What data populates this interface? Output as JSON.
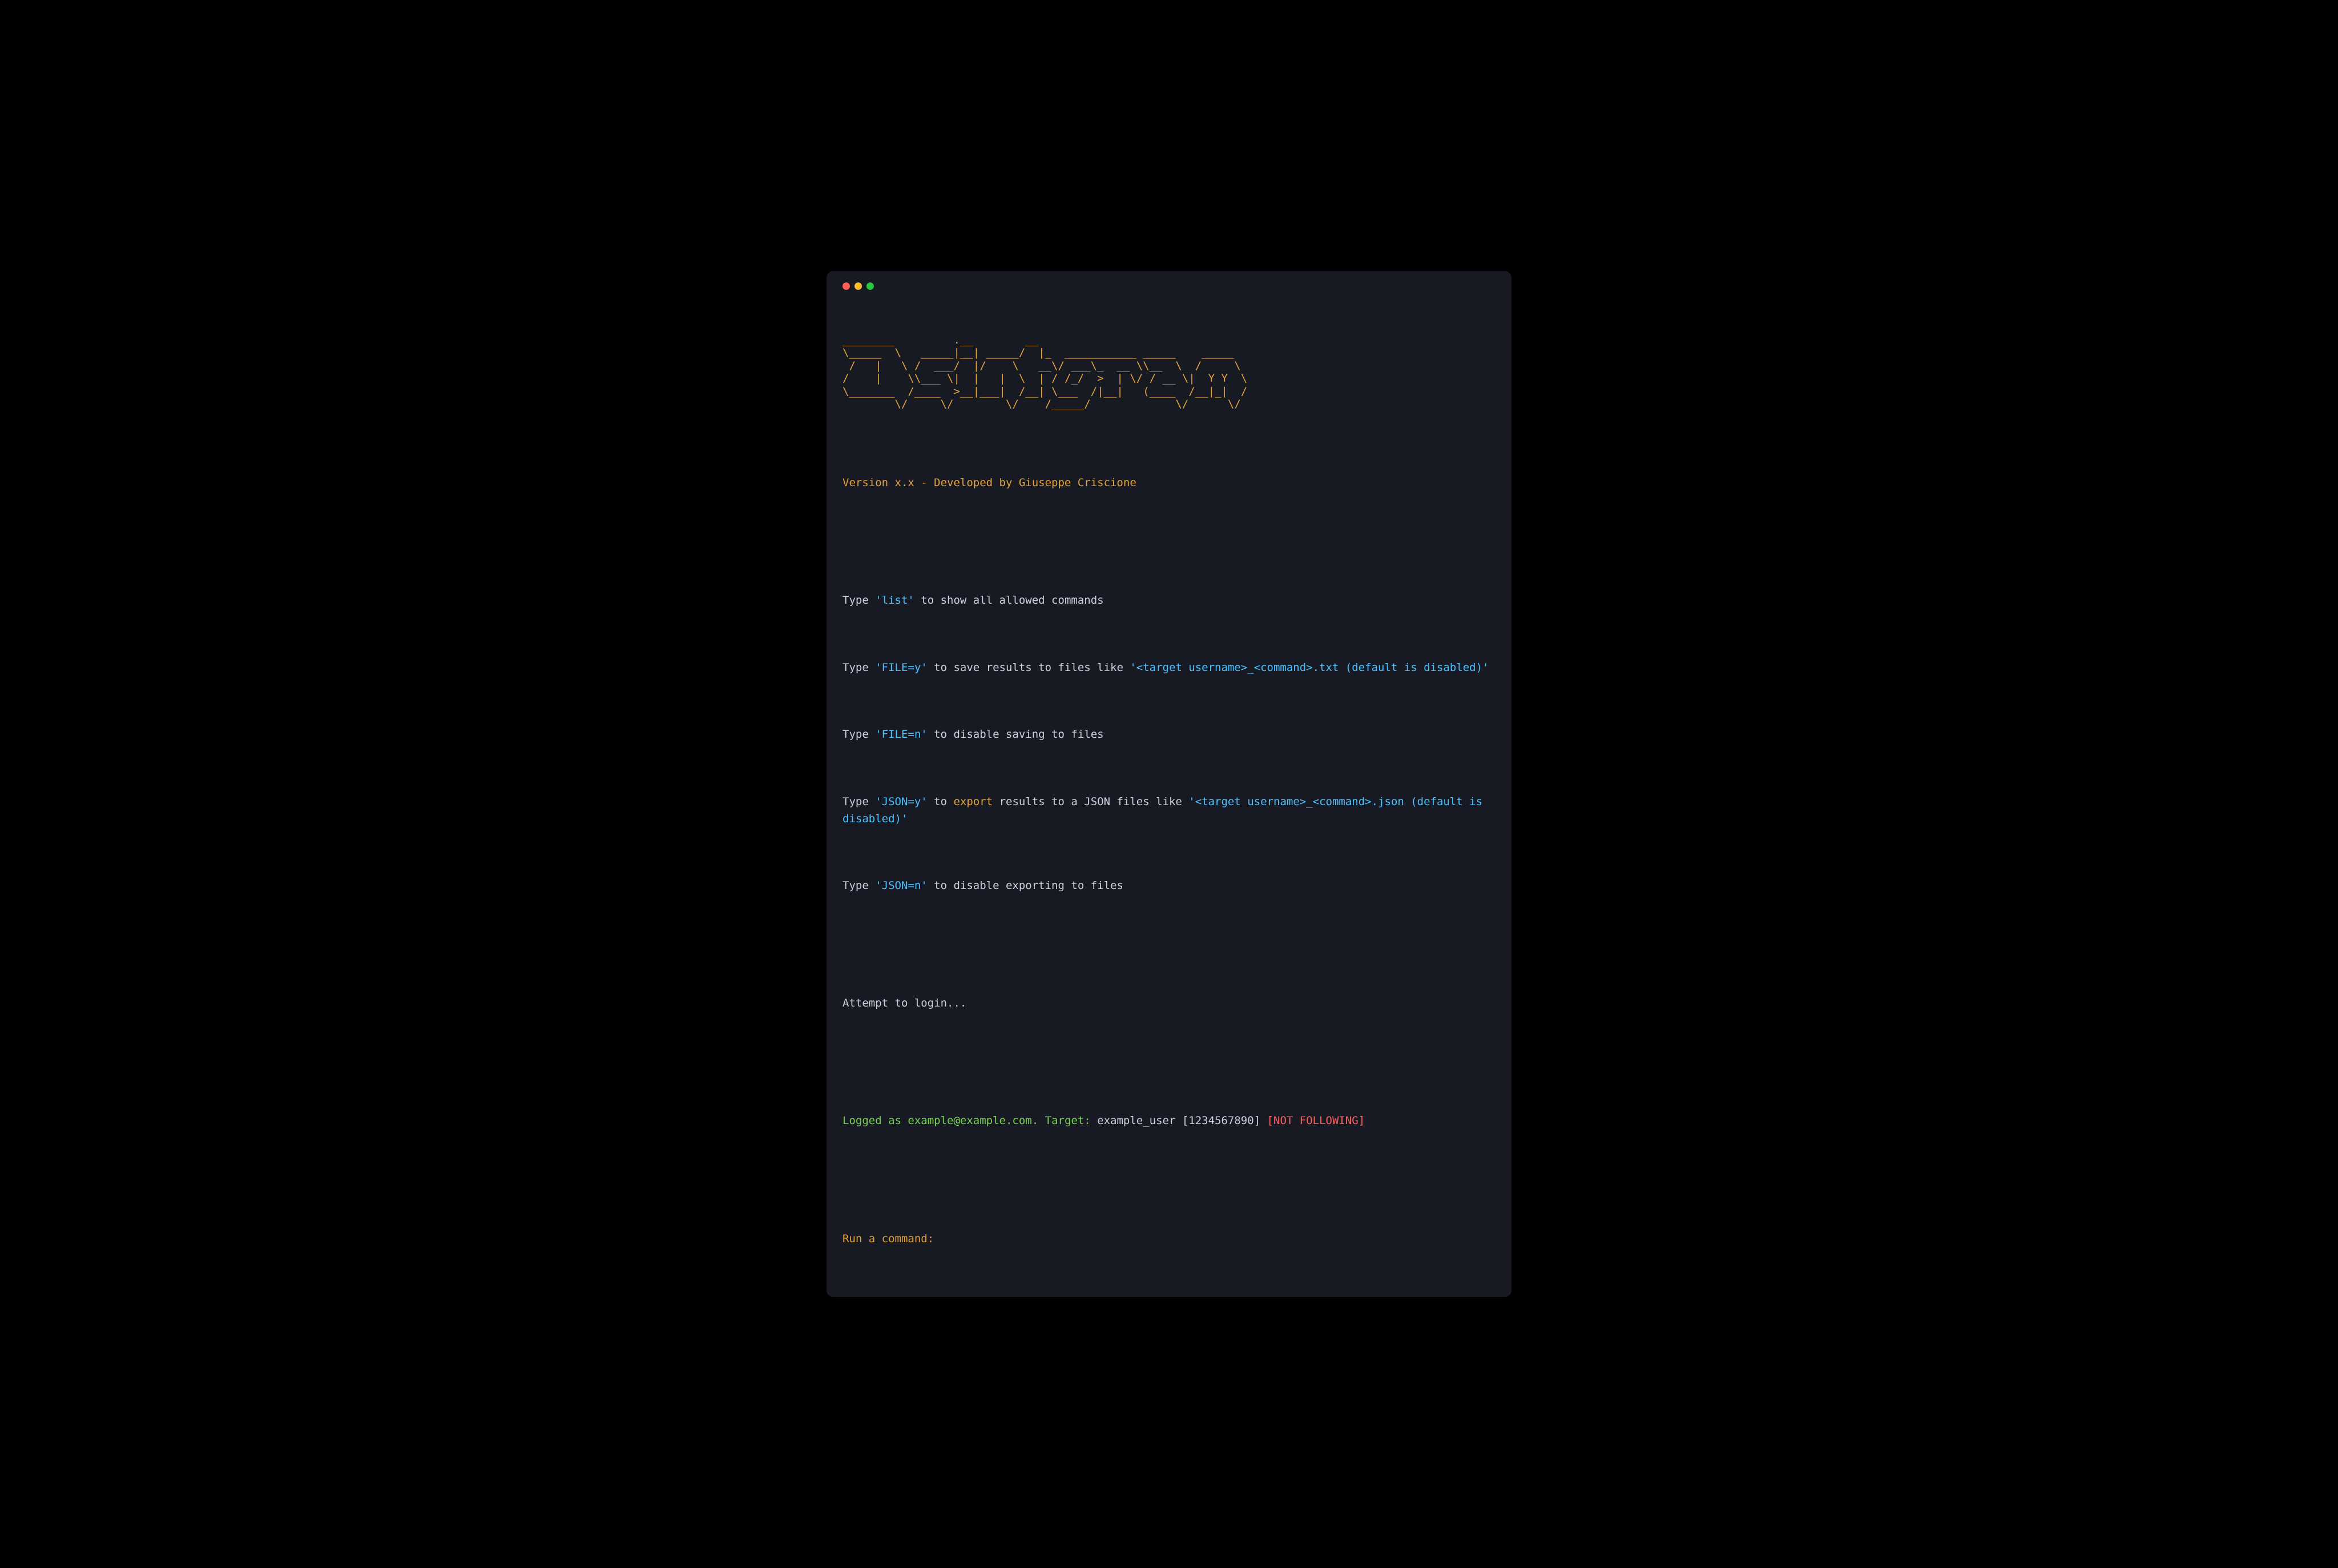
{
  "ascii_banner": "________         .__        __                                  \n\\_____  \\   _____|__| _____/  |_  ___________ _____    _____   \n /   |   \\ /  ___/  |/    \\   __\\/ ___\\_  __ \\\\__  \\  /     \\  \n/    |    \\\\___ \\|  |   |  \\  | / /_/  >  | \\/ / __ \\|  Y Y  \\ \n\\_______  /____  >__|___|  /__| \\___  /|__|   (____  /__|_|  / \n        \\/     \\/        \\/    /_____/             \\/      \\/ ",
  "version_line": "Version x.x - Developed by Giuseppe Criscione",
  "help": {
    "list": {
      "prefix": "Type ",
      "cmd": "'list'",
      "suffix": " to show all allowed commands"
    },
    "file_y": {
      "prefix": "Type ",
      "cmd": "'FILE=y'",
      "mid": " to save results to files like ",
      "example": "'<target username>_<command>.txt (default is disabled)'"
    },
    "file_n": {
      "prefix": "Type ",
      "cmd": "'FILE=n'",
      "suffix": " to disable saving to files"
    },
    "json_y": {
      "prefix": "Type ",
      "cmd": "'JSON=y'",
      "mid1": " to ",
      "export": "export",
      "mid2": " results to a JSON files like ",
      "example": "'<target username>_<command>.json (default is disabled)'"
    },
    "json_n": {
      "prefix": "Type ",
      "cmd": "'JSON=n'",
      "suffix": " to disable exporting to files"
    }
  },
  "login_attempt": "Attempt to login...",
  "status": {
    "logged_prefix": "Logged as ",
    "email": "example@example.com",
    "dot": ". ",
    "target_label": "Target: ",
    "target_value": "example_user [1234567890] ",
    "follow": "[NOT FOLLOWING]"
  },
  "prompt": "Run a command: "
}
